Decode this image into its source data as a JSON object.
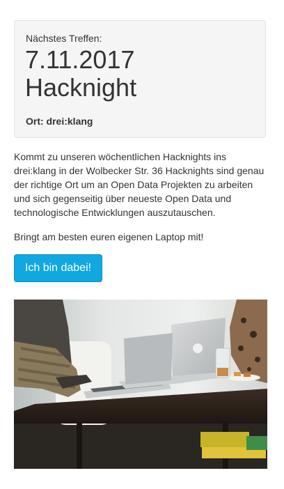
{
  "event": {
    "next_label": "Nächstes Treffen:",
    "date": "7.11.2017",
    "name": "Hacknight",
    "location": "Ort: drei:klang"
  },
  "content": {
    "description": "Kommt zu unseren wöchentlichen Hacknights ins drei:klang in der Wolbecker Str. 36 Hacknights sind genau der richtige Ort um an Open Data Projekten zu arbeiten und sich gegenseitig über neueste Open Data und technologische Entwicklungen auszutauschen.",
    "laptop_note": "Bringt am besten euren eigenen Laptop mit!",
    "join_button_label": "Ich bin dabei!"
  },
  "colors": {
    "button_bg": "#11a7e0",
    "card_bg": "#f5f5f5",
    "text": "#333333"
  },
  "image": {
    "subject": "people-working-on-laptops-photo"
  }
}
